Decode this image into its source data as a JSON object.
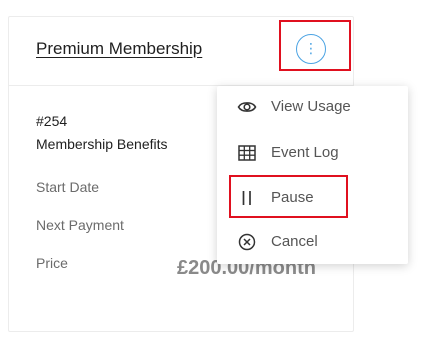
{
  "card": {
    "title": "Premium Membership",
    "menu_glyph": "⋮",
    "id": "#254",
    "benefits_label": "Membership Benefits",
    "fields": {
      "start_date_label": "Start Date",
      "next_payment_label": "Next Payment",
      "price_label": "Price",
      "price_value": "£200.00/month"
    }
  },
  "menu": {
    "items": [
      {
        "label": "View Usage",
        "icon": "eye-icon"
      },
      {
        "label": "Event Log",
        "icon": "table-icon"
      },
      {
        "label": "Pause",
        "icon": "pause-icon"
      },
      {
        "label": "Cancel",
        "icon": "cancel-circle-icon"
      }
    ]
  },
  "colors": {
    "accent": "#4ba3e3",
    "highlight": "#e0101f",
    "text": "#1f1f1f",
    "muted": "#6b6b6b"
  }
}
